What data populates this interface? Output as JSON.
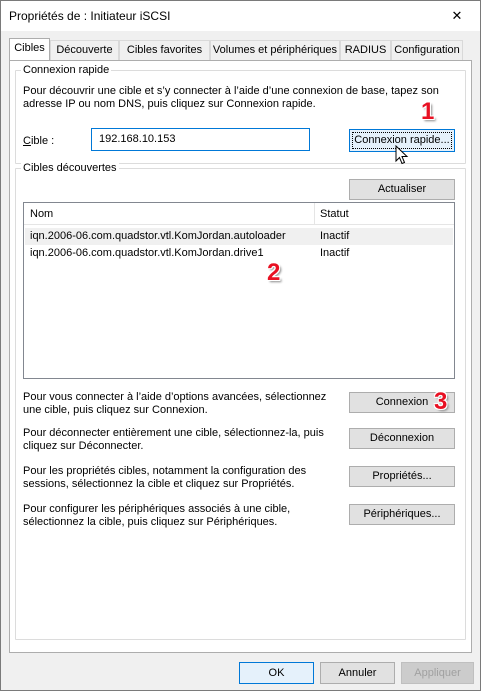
{
  "window": {
    "title": "Propriétés de : Initiateur iSCSI",
    "close_glyph": "✕"
  },
  "tabs": [
    {
      "label": "Cibles",
      "active": true
    },
    {
      "label": "Découverte"
    },
    {
      "label": "Cibles favorites"
    },
    {
      "label": "Volumes et périphériques"
    },
    {
      "label": "RADIUS"
    },
    {
      "label": "Configuration"
    }
  ],
  "quick_connect": {
    "group_label": "Connexion rapide",
    "description": "Pour découvrir une cible et s’y connecter à l’aide d’une connexion de base, tapez son adresse IP ou nom DNS, puis cliquez sur Connexion rapide.",
    "target_label_prefix": "C",
    "target_label_rest": "ible :",
    "target_value": "192.168.10.153",
    "button_label": "Connexion rapide..."
  },
  "discovered": {
    "group_label": "Cibles découvertes",
    "refresh_button": "Actualiser",
    "columns": {
      "name": "Nom",
      "status": "Statut"
    },
    "rows": [
      {
        "name": "iqn.2006-06.com.quadstor.vtl.KomJordan.autoloader",
        "status": "Inactif"
      },
      {
        "name": "iqn.2006-06.com.quadstor.vtl.KomJordan.drive1",
        "status": "Inactif"
      }
    ]
  },
  "actions": [
    {
      "text": "Pour vous connecter à l’aide d’options avancées, sélectionnez une cible, puis cliquez sur Connexion.",
      "button": "Connexion"
    },
    {
      "text": "Pour déconnecter entièrement une cible, sélectionnez-la, puis cliquez sur Déconnecter.",
      "button": "Déconnexion"
    },
    {
      "text": "Pour les propriétés cibles, notamment la configuration des sessions, sélectionnez la cible et cliquez sur Propriétés.",
      "button": "Propriétés..."
    },
    {
      "text": "Pour configurer les périphériques associés à une cible, sélectionnez la cible, puis cliquez sur Périphériques.",
      "button": "Périphériques..."
    }
  ],
  "footer": {
    "ok": "OK",
    "cancel": "Annuler",
    "apply": "Appliquer"
  },
  "markers": [
    "1",
    "2",
    "3"
  ],
  "colors": {
    "accent": "#0078d7",
    "marker": "#e81123"
  }
}
